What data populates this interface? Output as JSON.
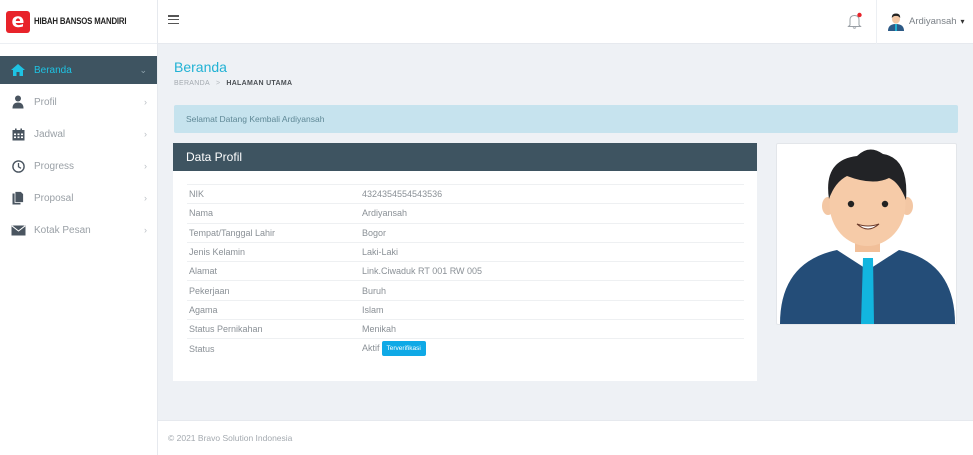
{
  "brand": {
    "logo_letter": "e",
    "name": "HIBAH BANSOS MANDIRI"
  },
  "sidebar": {
    "items": [
      {
        "label": "Beranda",
        "icon": "home-icon",
        "active": true
      },
      {
        "label": "Profil",
        "icon": "user-icon",
        "active": false
      },
      {
        "label": "Jadwal",
        "icon": "calendar-icon",
        "active": false
      },
      {
        "label": "Progress",
        "icon": "clock-icon",
        "active": false
      },
      {
        "label": "Proposal",
        "icon": "document-icon",
        "active": false
      },
      {
        "label": "Kotak Pesan",
        "icon": "envelope-icon",
        "active": false
      }
    ]
  },
  "topbar": {
    "user_name": "Ardiyansah"
  },
  "page": {
    "title": "Beranda",
    "breadcrumb": {
      "root": "BERANDA",
      "separator": ">",
      "current": "HALAMAN UTAMA"
    }
  },
  "alert": {
    "text": "Selamat Datang Kembali Ardiyansah"
  },
  "profile": {
    "header": "Data Profil",
    "rows": [
      {
        "label": "NIK",
        "value": "4324354554543536"
      },
      {
        "label": "Nama",
        "value": "Ardiyansah"
      },
      {
        "label": "Tempat/Tanggal Lahir",
        "value": "Bogor"
      },
      {
        "label": "Jenis Kelamin",
        "value": "Laki-Laki"
      },
      {
        "label": "Alamat",
        "value": "Link.Ciwaduk RT 001 RW 005"
      },
      {
        "label": "Pekerjaan",
        "value": "Buruh"
      },
      {
        "label": "Agama",
        "value": "Islam"
      },
      {
        "label": "Status Pernikahan",
        "value": "Menikah"
      },
      {
        "label": "Status",
        "value": "Aktif",
        "badge": "Terverifikasi"
      }
    ]
  },
  "footer": {
    "text": "© 2021 Bravo Solution Indonesia"
  },
  "colors": {
    "accent": "#1ec3e3",
    "sidebar_active_bg": "#3e5461",
    "card_header_bg": "#3e5461",
    "alert_bg": "#c6e3ee",
    "badge_bg": "#0fa9e6",
    "brand_red": "#e8232a"
  }
}
